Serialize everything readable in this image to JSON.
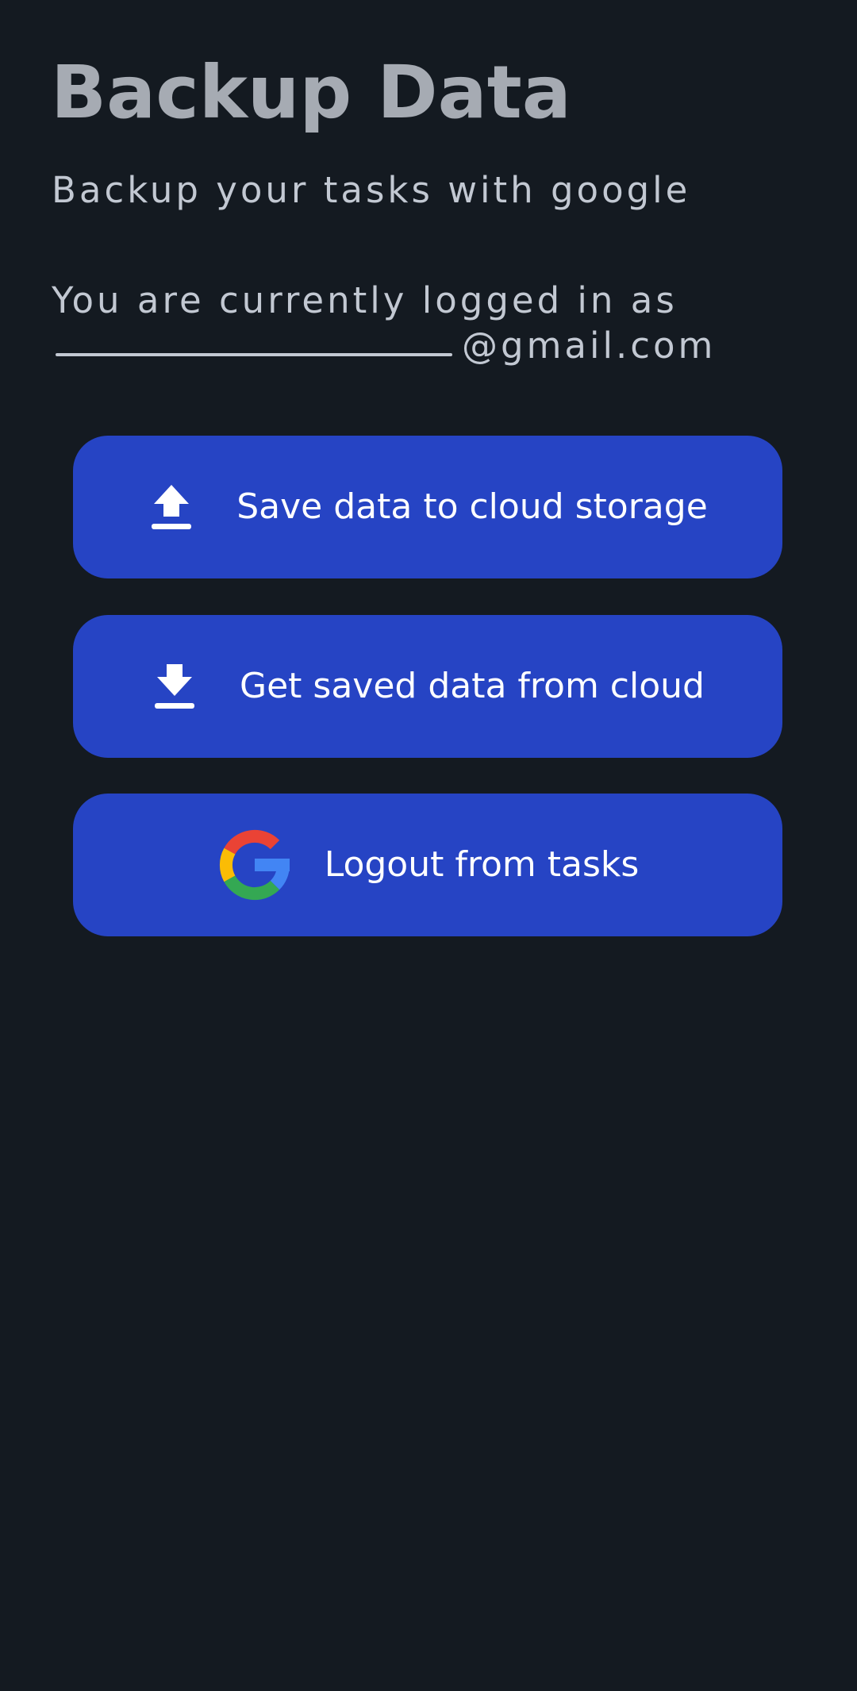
{
  "header": {
    "title": "Backup Data",
    "subtitle": "Backup your tasks with google"
  },
  "account": {
    "status_text": "You are currently logged in as",
    "email_domain": "@gmail.com"
  },
  "actions": {
    "save_label": "Save data to cloud storage",
    "get_label": "Get saved data from cloud",
    "logout_label": "Logout from tasks"
  },
  "icons": {
    "save": "upload-icon",
    "get": "download-icon",
    "logout": "google-logo-icon"
  },
  "colors": {
    "background": "#141a21",
    "button": "#2644c4",
    "title": "#a6abb3",
    "text": "#c2c8d2",
    "button_text": "#ffffff"
  }
}
